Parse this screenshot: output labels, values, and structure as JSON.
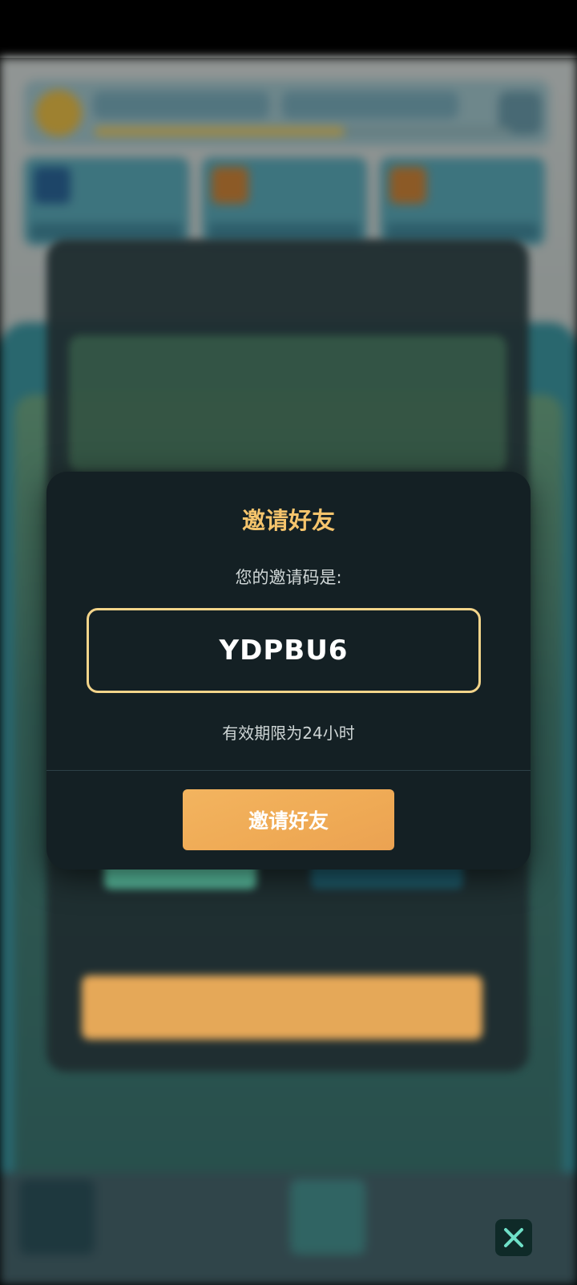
{
  "invite": {
    "title": "邀请好友",
    "label": "您的邀请码是:",
    "code": "YDPBU6",
    "expiry": "有效期限为24小时",
    "button_label": "邀请好友"
  },
  "icons": {
    "close": "close-icon"
  },
  "colors": {
    "accent": "#f5c46c",
    "button": "#efaa55",
    "modal_bg": "#142024",
    "code_border": "#f3d48a"
  }
}
